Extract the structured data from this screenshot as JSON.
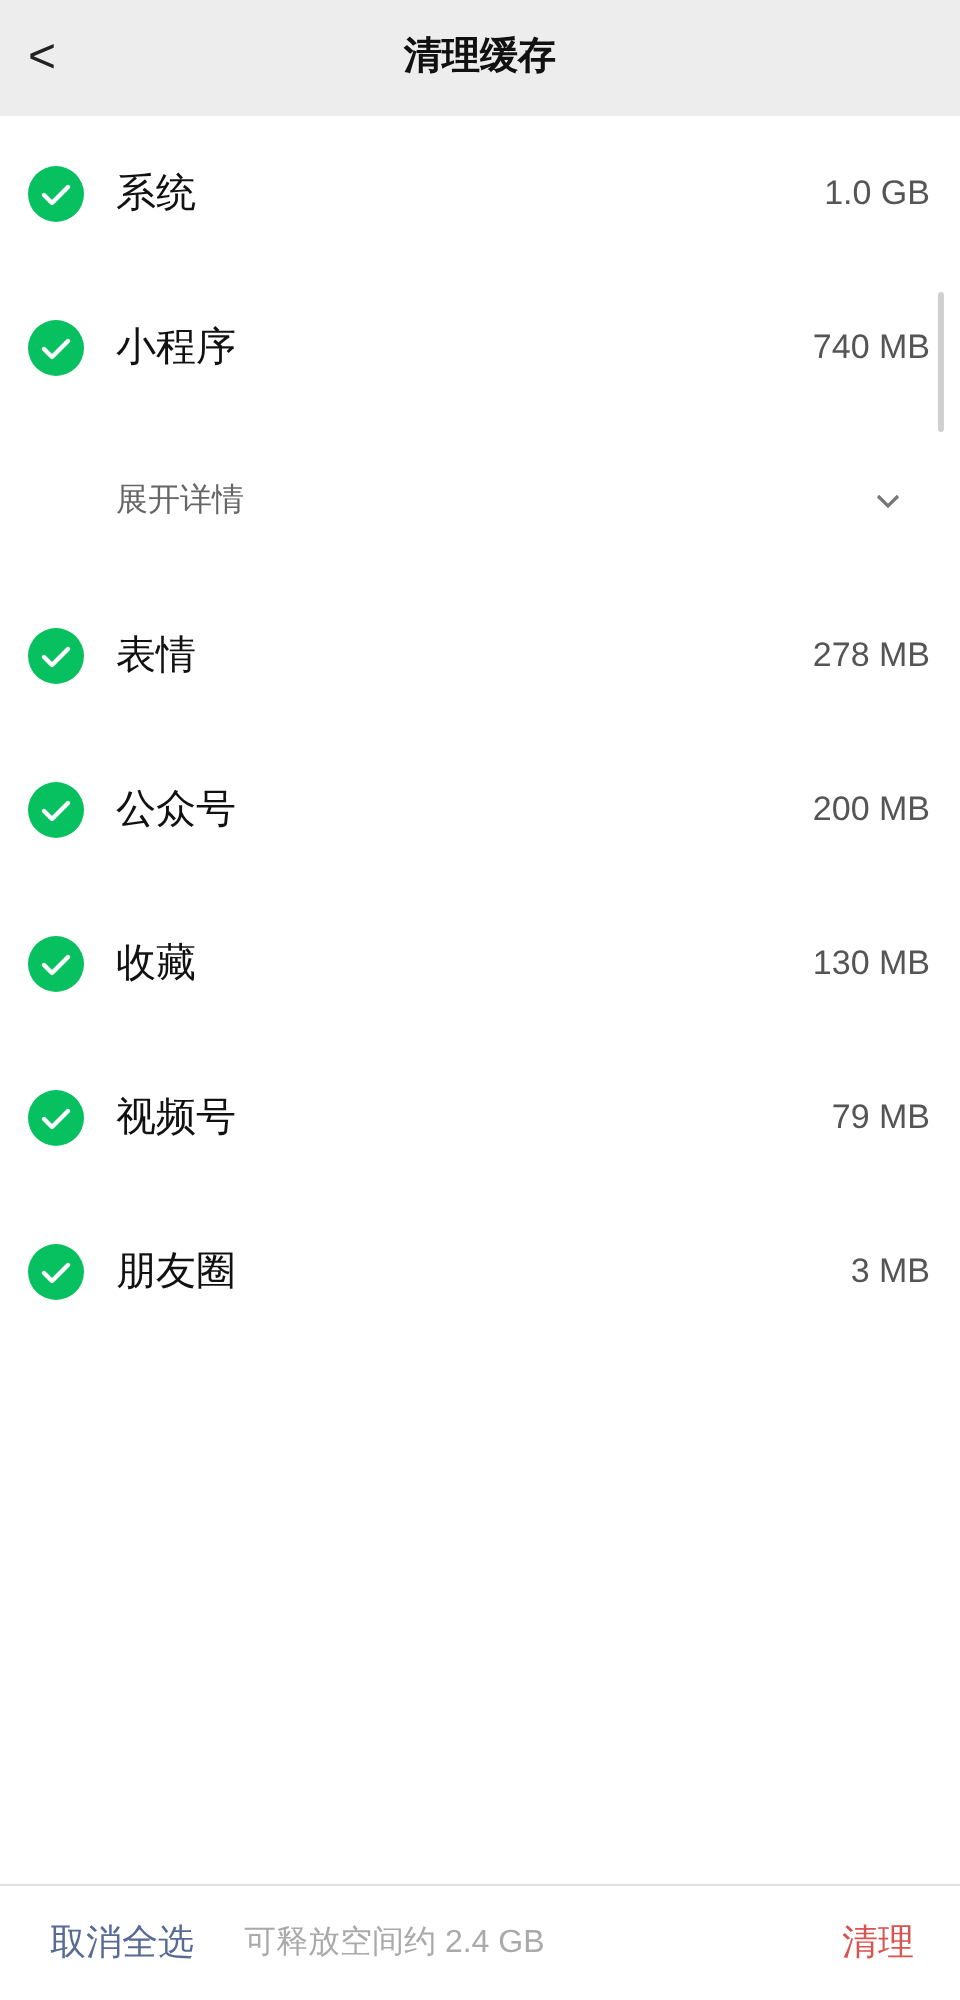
{
  "header": {
    "back": "<",
    "title": "清理缓存"
  },
  "items": [
    {
      "kind": "category",
      "label": "系统",
      "size": "1.0 GB",
      "checked": true
    },
    {
      "kind": "category",
      "label": "小程序",
      "size": "740 MB",
      "checked": true
    },
    {
      "kind": "expand",
      "label": "展开详情",
      "expanded": false
    },
    {
      "kind": "category",
      "label": "表情",
      "size": "278 MB",
      "checked": true
    },
    {
      "kind": "category",
      "label": "公众号",
      "size": "200 MB",
      "checked": true
    },
    {
      "kind": "category",
      "label": "收藏",
      "size": "130 MB",
      "checked": true
    },
    {
      "kind": "category",
      "label": "视频号",
      "size": "79 MB",
      "checked": true
    },
    {
      "kind": "category",
      "label": "朋友圈",
      "size": "3 MB",
      "checked": true
    }
  ],
  "footer": {
    "deselect_all": "取消全选",
    "summary": "可释放空间约 2.4 GB",
    "clean": "清理"
  }
}
